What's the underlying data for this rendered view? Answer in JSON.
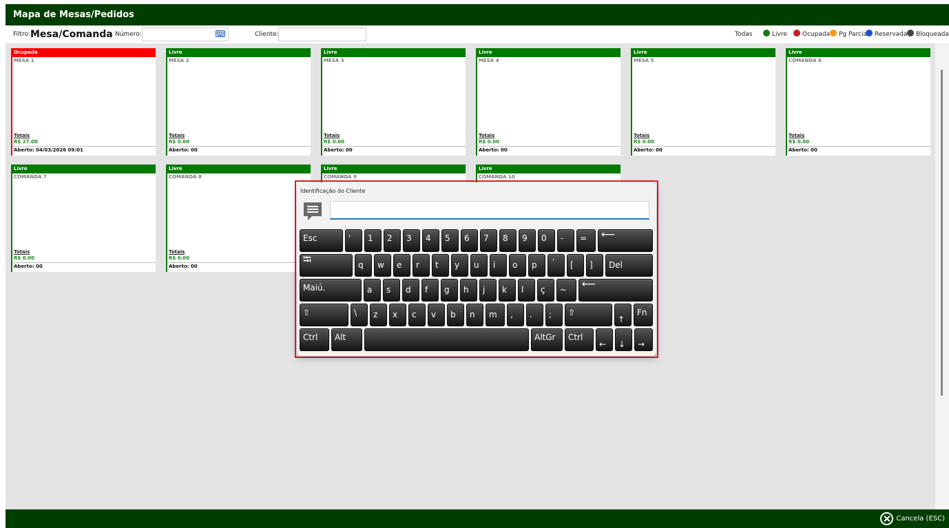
{
  "title": "Mapa de Mesas/Pedidos",
  "filter": {
    "label": "Filtro:",
    "value": "Mesa/Comanda",
    "numero_label": "Número:",
    "numero_value": "",
    "cliente_label": "Cliente:",
    "cliente_value": ""
  },
  "legend": {
    "all": "Todas",
    "items": [
      {
        "label": "Livre",
        "color": "#1a7a1a"
      },
      {
        "label": "Ocupada",
        "color": "#c81e1e"
      },
      {
        "label": "Pg Parcial",
        "color": "#f59a1a"
      },
      {
        "label": "Reservada",
        "color": "#1e4fd0"
      },
      {
        "label": "Bloqueada",
        "color": "#444444"
      }
    ]
  },
  "tables": [
    {
      "status": "Ocupada",
      "name": "MESA 1",
      "totals_label": "Totais",
      "total": "R$ 27.00",
      "opened": "Aberto: 04/03/2026 09:01"
    },
    {
      "status": "Livre",
      "name": "MESA 2",
      "totals_label": "Totais",
      "total": "R$ 0.00",
      "opened": "Aberto: 00"
    },
    {
      "status": "Livre",
      "name": "MESA 3",
      "totals_label": "Totais",
      "total": "R$ 0.00",
      "opened": "Aberto: 00"
    },
    {
      "status": "Livre",
      "name": "MESA 4",
      "totals_label": "Totais",
      "total": "R$ 0.00",
      "opened": "Aberto: 00"
    },
    {
      "status": "Livre",
      "name": "MESA 5",
      "totals_label": "Totais",
      "total": "R$ 0.00",
      "opened": "Aberto: 00"
    },
    {
      "status": "Livre",
      "name": "COMANDA 6",
      "totals_label": "Totais",
      "total": "R$ 0.00",
      "opened": "Aberto: 00"
    },
    {
      "status": "Livre",
      "name": "COMANDA 7",
      "totals_label": "Totais",
      "total": "R$ 0.00",
      "opened": "Aberto: 00"
    },
    {
      "status": "Livre",
      "name": "COMANDA 8",
      "totals_label": "Totais",
      "total": "R$ 0.00",
      "opened": "Aberto: 00"
    },
    {
      "status": "Livre",
      "name": "COMANDA 9",
      "totals_label": "",
      "total": "",
      "opened": ""
    },
    {
      "status": "Livre",
      "name": "COMANDA 10",
      "totals_label": "",
      "total": "",
      "opened": ""
    }
  ],
  "keyboard": {
    "title": "Identificação do Cliente",
    "input_value": "",
    "icons": {
      "chat": "chat-icon",
      "keyboard": "keyboard-icon",
      "cancel": "cancel-icon"
    },
    "rows": [
      [
        "Esc",
        "'",
        "1",
        "2",
        "3",
        "4",
        "5",
        "6",
        "7",
        "8",
        "9",
        "0",
        "-",
        "=",
        "⟵"
      ],
      [
        "⭾",
        "q",
        "w",
        "e",
        "r",
        "t",
        "y",
        "u",
        "i",
        "o",
        "p",
        "´",
        "[",
        "]",
        "Del"
      ],
      [
        "Maiú.",
        "a",
        "s",
        "d",
        "f",
        "g",
        "h",
        "j",
        "k",
        "l",
        "ç",
        "~",
        "⟵"
      ],
      [
        "⇧",
        "\\",
        "z",
        "x",
        "c",
        "v",
        "b",
        "n",
        "m",
        ",",
        ".",
        ";",
        "⇧",
        "↑",
        "Fn"
      ],
      [
        "Ctrl",
        "Alt",
        "",
        "AltGr",
        "Ctrl",
        "←",
        "↓",
        "→"
      ]
    ]
  },
  "footer": {
    "cancel_label": "Cancela (ESC)"
  }
}
